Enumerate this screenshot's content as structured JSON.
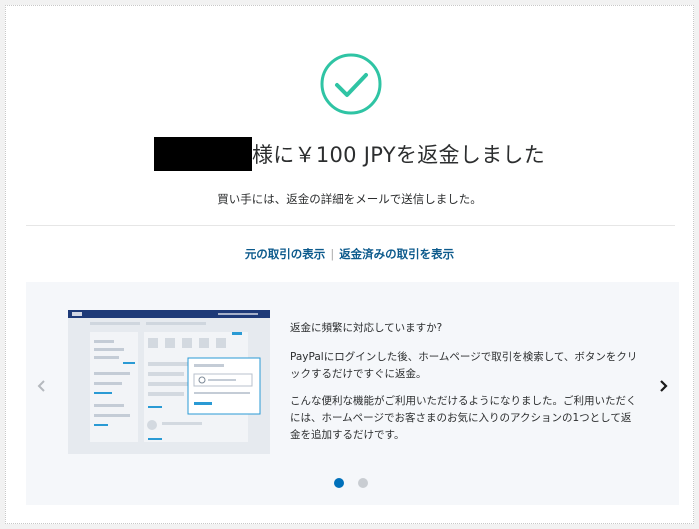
{
  "status": {
    "icon": "check-circle-icon",
    "accent_color": "#2fc4a4",
    "title_text": "様に￥100 JPYを返金しました",
    "subtitle": "買い手には、返金の詳細をメールで送信しました。"
  },
  "links": {
    "original_transaction": "元の取引の表示",
    "separator": "|",
    "refunded_transaction": "返金済みの取引を表示"
  },
  "promo": {
    "heading": "返金に頻繁に対応していますか?",
    "paragraph1": "PayPalにログインした後、ホームページで取引を検索して、ボタンをクリックするだけですぐに返金。",
    "paragraph2": "こんな便利な機能がご利用いただけるようになりました。ご利用いただくには、ホームページでお客さまのお気に入りのアクションの1つとして返金を追加するだけです。",
    "prev_icon": "chevron-left-icon",
    "next_icon": "chevron-right-icon",
    "slides": [
      {
        "active": true
      },
      {
        "active": false
      }
    ]
  }
}
